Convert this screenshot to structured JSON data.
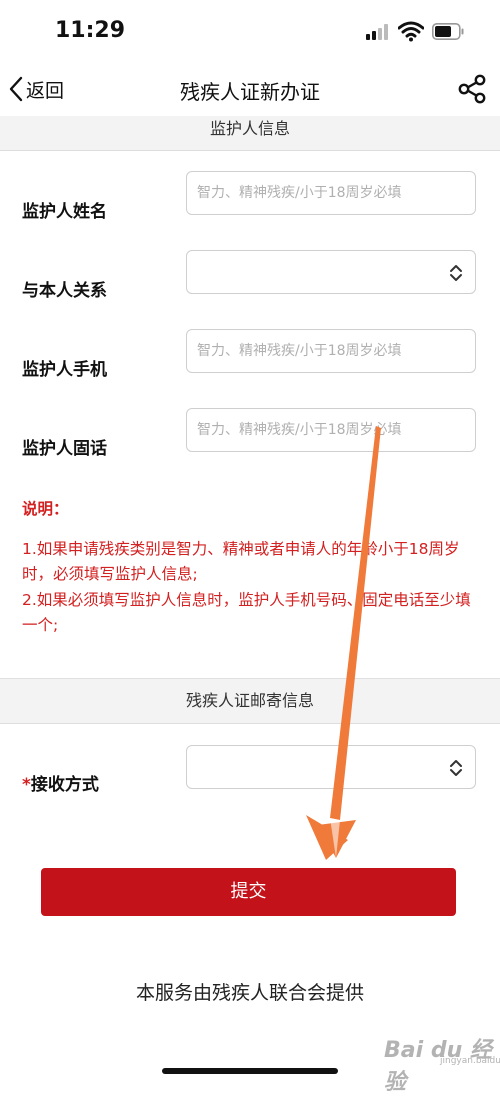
{
  "status_bar": {
    "time": "11:29"
  },
  "nav": {
    "back_label": "返回",
    "title": "残疾人证新办证"
  },
  "guardian_section": {
    "title": "监护人信息",
    "fields": [
      {
        "label": "监护人姓名",
        "placeholder": "智力、精神残疾/小于18周岁必填"
      },
      {
        "label": "与本人关系",
        "value": ""
      },
      {
        "label": "监护人手机",
        "placeholder": "智力、精神残疾/小于18周岁必填"
      },
      {
        "label": "监护人固话",
        "placeholder": "智力、精神残疾/小于18周岁必填"
      }
    ]
  },
  "notes": {
    "title": "说明：",
    "items": [
      "1.如果申请残疾类别是智力、精神或者申请人的年龄小于18周岁时，必须填写监护人信息;",
      "2.如果必须填写监护人信息时，监护人手机号码、固定电话至少填一个;"
    ]
  },
  "mail_section": {
    "title": "残疾人证邮寄信息",
    "required_mark": "*",
    "receive_label": "接收方式",
    "receive_value": ""
  },
  "submit_label": "提交",
  "footer": "本服务由残疾人联合会提供",
  "watermark": {
    "text": "Bai du 经验",
    "sub": "jingyan.baidu.com"
  },
  "colors": {
    "accent": "#c4121a",
    "note_red": "#d32020",
    "annotation_orange": "#f07a3a"
  }
}
